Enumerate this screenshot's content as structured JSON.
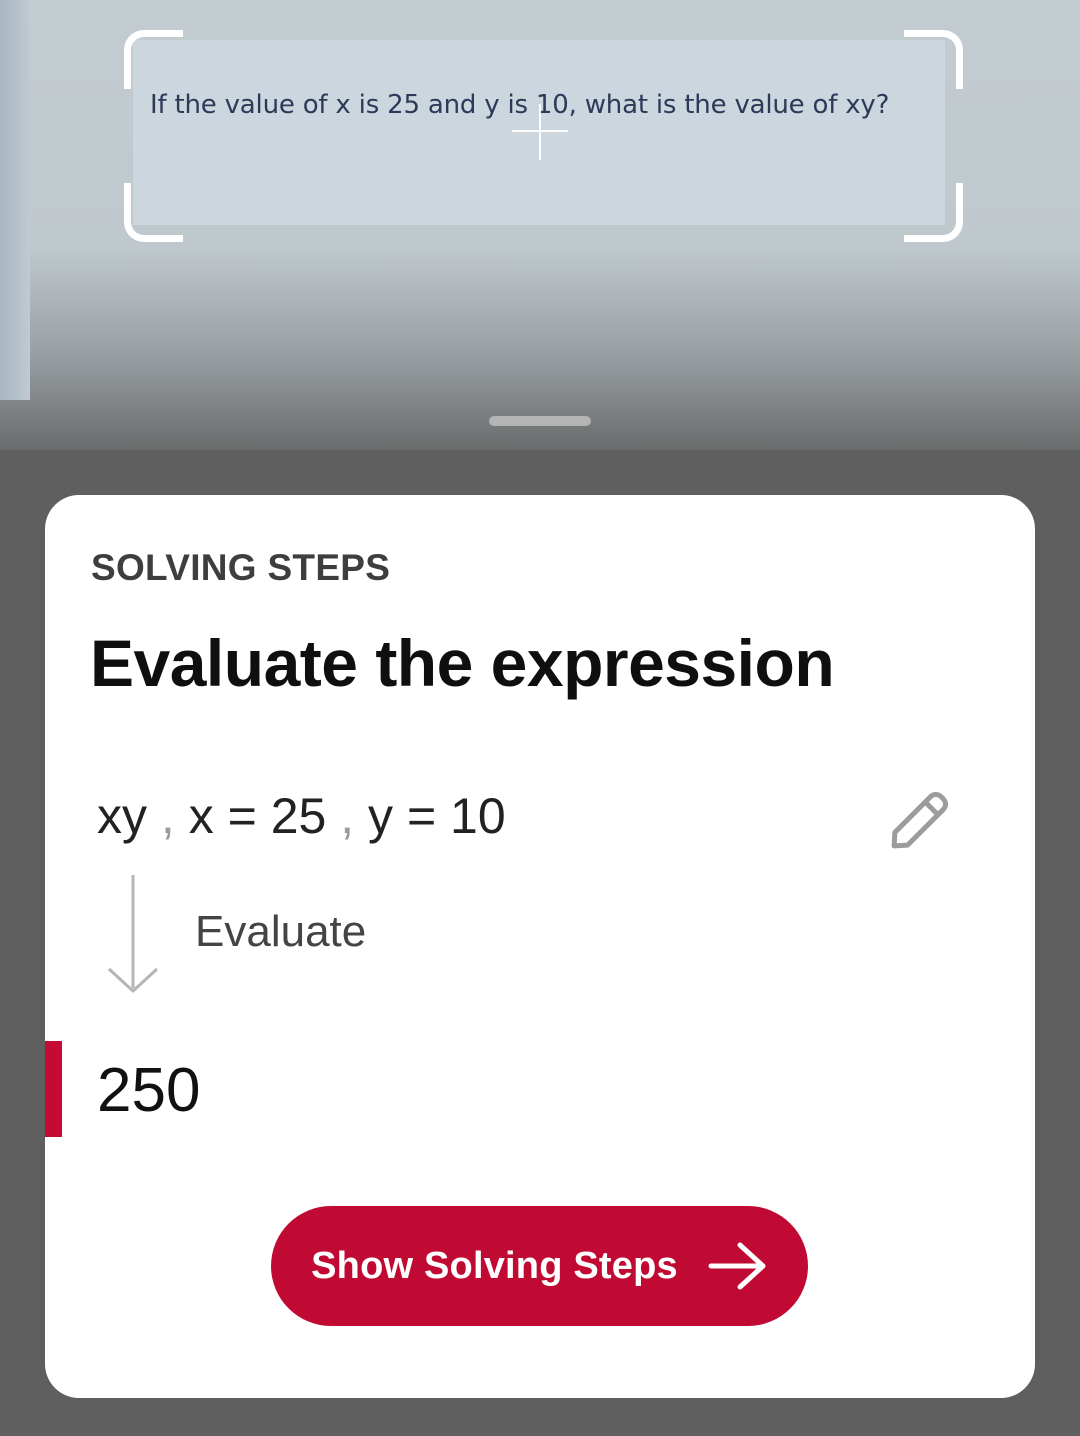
{
  "camera": {
    "scanned_text": "If the value of x is 25 and y is 10, what is the value of xy?"
  },
  "card": {
    "section_label": "SOLVING STEPS",
    "title": "Evaluate the expression",
    "expression": {
      "parts": [
        "xy",
        ",",
        "x = 25",
        ",",
        "y = 10"
      ]
    },
    "step_label": "Evaluate",
    "answer": "250",
    "button_label": "Show Solving Steps"
  },
  "icons": {
    "edit": "pencil-icon",
    "step": "arrow-down-icon",
    "button": "arrow-right-icon"
  },
  "colors": {
    "accent": "#c10a33",
    "answer_marker": "#c50b35",
    "card_background": "#ffffff",
    "backdrop": "#5f5f5f"
  }
}
